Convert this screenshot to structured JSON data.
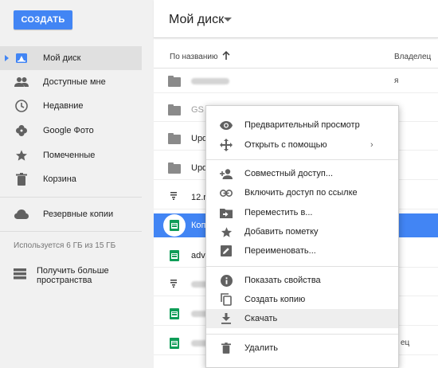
{
  "sidebar": {
    "create_label": "СОЗДАТЬ",
    "items": [
      {
        "label": "Мой диск",
        "icon": "drive-icon"
      },
      {
        "label": "Доступные мне",
        "icon": "people-icon"
      },
      {
        "label": "Недавние",
        "icon": "clock-icon"
      },
      {
        "label": "Google Фото",
        "icon": "pinwheel-icon"
      },
      {
        "label": "Помеченные",
        "icon": "star-icon"
      },
      {
        "label": "Корзина",
        "icon": "trash-icon"
      }
    ],
    "backups_label": "Резервные копии",
    "storage_text": "Используется 6 ГБ из 15 ГБ",
    "more_space_label": "Получить больше пространства"
  },
  "header": {
    "title": "Мой диск"
  },
  "columns": {
    "name": "По названию",
    "owner": "Владелец"
  },
  "files": [
    {
      "name": "",
      "type": "folder",
      "owner": "я"
    },
    {
      "name": "GS",
      "type": "folder",
      "owner": ""
    },
    {
      "name": "Upd",
      "type": "folder",
      "owner": ""
    },
    {
      "name": "Upd",
      "type": "folder",
      "owner": ""
    },
    {
      "name": "12.r",
      "type": "doc",
      "owner": ""
    },
    {
      "name": "Коп",
      "type": "sheet",
      "owner": "",
      "selected": true
    },
    {
      "name": "adv",
      "type": "sheet",
      "owner": ""
    },
    {
      "name": "",
      "type": "doc",
      "owner": ""
    },
    {
      "name": "",
      "type": "sheet",
      "owner": ""
    },
    {
      "name": "",
      "type": "sheet",
      "owner": "ец"
    }
  ],
  "context_menu": {
    "items": [
      {
        "label": "Предварительный просмотр",
        "icon": "eye-icon"
      },
      {
        "label": "Открыть с помощью",
        "icon": "move-arrows-icon",
        "submenu": "›"
      },
      {
        "label": "Совместный доступ...",
        "icon": "add-person-icon"
      },
      {
        "label": "Включить доступ по ссылке",
        "icon": "link-icon"
      },
      {
        "label": "Переместить в...",
        "icon": "folder-move-icon"
      },
      {
        "label": "Добавить пометку",
        "icon": "star-icon"
      },
      {
        "label": "Переименовать...",
        "icon": "pencil-icon"
      },
      {
        "label": "Показать свойства",
        "icon": "info-icon"
      },
      {
        "label": "Создать копию",
        "icon": "copy-icon"
      },
      {
        "label": "Скачать",
        "icon": "download-icon"
      },
      {
        "label": "Удалить",
        "icon": "trash-icon"
      }
    ]
  },
  "colors": {
    "accent": "#4285f4",
    "sidebar_bg": "#f1f1f1",
    "sheet_green": "#0f9d58"
  }
}
